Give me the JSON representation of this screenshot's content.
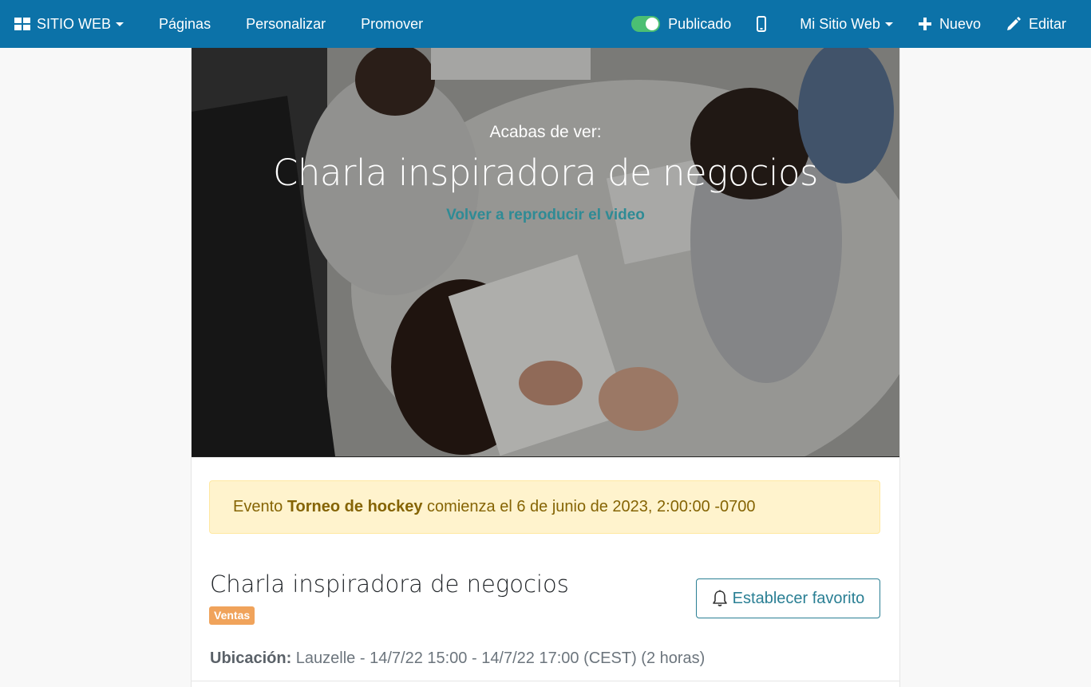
{
  "navbar": {
    "brand": "SITIO WEB",
    "links": [
      "Páginas",
      "Personalizar",
      "Promover"
    ],
    "published_label": "Publicado",
    "site_selector": "Mi Sitio Web",
    "new_label": "Nuevo",
    "edit_label": "Editar",
    "icons": {
      "brand": "grid-icon",
      "mobile": "mobile-icon",
      "new": "plus-icon",
      "edit": "pencil-icon"
    },
    "color": "#0c72a8"
  },
  "hero": {
    "kicker": "Acabas de ver:",
    "title": "Charla inspiradora de negocios",
    "replay_link": "Volver a reproducir el video"
  },
  "alert": {
    "prefix": "Evento ",
    "event_name": "Torneo de hockey",
    "suffix": " comienza el 6 de junio de 2023, 2:00:00 -0700"
  },
  "event": {
    "title": "Charla inspiradora de negocios",
    "tag": "Ventas",
    "favorite_button": "Establecer favorito",
    "location_label": "Ubicación:",
    "location_value": " Lauzelle - 14/7/22 15:00 - 14/7/22 17:00 (CEST) (2 horas)"
  }
}
